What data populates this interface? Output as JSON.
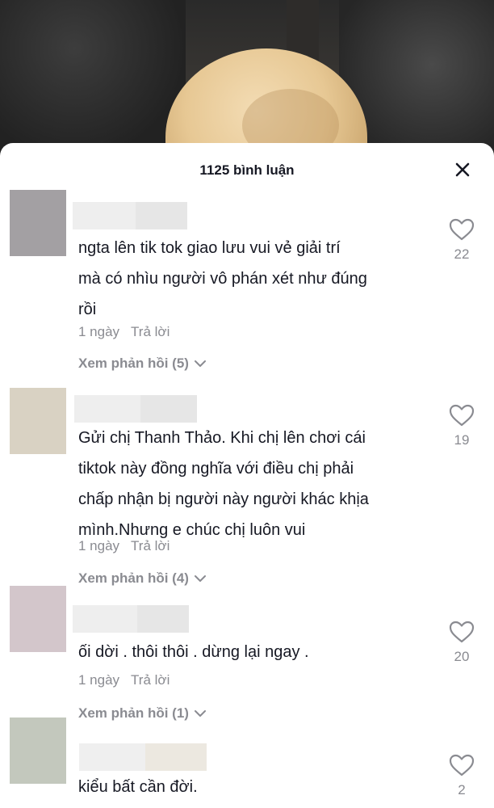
{
  "header": {
    "title": "1125 bình luận"
  },
  "icons": {
    "close": "close-icon",
    "like": "heart-outline-icon",
    "expand": "chevron-down-icon"
  },
  "colors": {
    "text": "#161823",
    "muted": "#8a8b91",
    "sheet": "#ffffff"
  },
  "comments": [
    {
      "avatar_color": "#a3a0a3",
      "text_lines": [
        "ngta lên tik tok giao lưu vui vẻ giải trí",
        "mà có nhìu người vô phán xét như đúng",
        "rồi"
      ],
      "time": "1 ngày",
      "reply_label": "Trả lời",
      "view_replies": "Xem phản hồi (5)",
      "likes": "22"
    },
    {
      "avatar_color": "#d9d2c3",
      "text_lines": [
        "Gửi chị Thanh Thảo. Khi chị lên chơi cái",
        "tiktok này đồng nghĩa với điều chị phải",
        "chấp nhận bị người này người khác khịa",
        "mình.Nhưng e chúc chị luôn vui"
      ],
      "time": "1 ngày",
      "reply_label": "Trả lời",
      "view_replies": "Xem phản hồi (4)",
      "likes": "19"
    },
    {
      "avatar_color": "#d3c6cb",
      "text_lines": [
        "ối dời . thôi thôi . dừng lại ngay ."
      ],
      "time": "1 ngày",
      "reply_label": "Trả lời",
      "view_replies": "Xem phản hồi (1)",
      "likes": "20"
    },
    {
      "avatar_color": "#c3c8bd",
      "text_lines": [
        "kiểu bất cần đời."
      ],
      "likes": "2"
    }
  ]
}
